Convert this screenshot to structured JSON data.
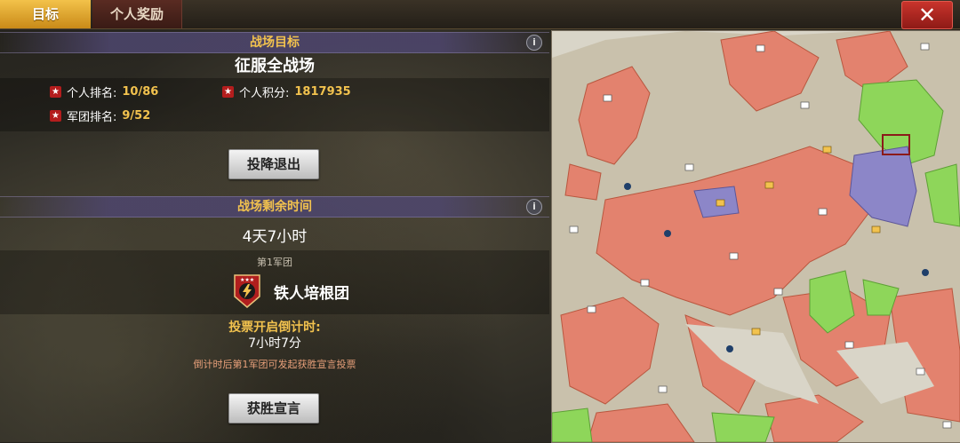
{
  "tabs": {
    "goal": "目标",
    "personal_reward": "个人奖励"
  },
  "close_label": "✕",
  "battlefield_goal": {
    "header": "战场目标",
    "objective": "征服全战场",
    "personal_rank_label": "个人排名:",
    "personal_rank_value": "10/86",
    "personal_score_label": "个人积分:",
    "personal_score_value": "1817935",
    "legion_rank_label": "军团排名:",
    "legion_rank_value": "9/52",
    "surrender_button": "投降退出"
  },
  "remaining_time": {
    "header": "战场剩余时间",
    "value": "4天7小时",
    "legion_label": "第1军团",
    "legion_name": "铁人培根团",
    "vote_countdown_label": "投票开启倒计时:",
    "vote_countdown_value": "7小时7分",
    "note": "倒计时后第1军团可发起获胜宣言投票",
    "victory_button": "获胜宣言"
  },
  "info_icon": "i",
  "colors": {
    "accent_gold": "#f2c24e",
    "close_red": "#c9342c",
    "red_territory": "#e3826e",
    "green_territory": "#8ed65a",
    "purple_territory": "#8c86c8",
    "neutral_land": "#c9c1ac",
    "sea": "#d8d4c6"
  }
}
